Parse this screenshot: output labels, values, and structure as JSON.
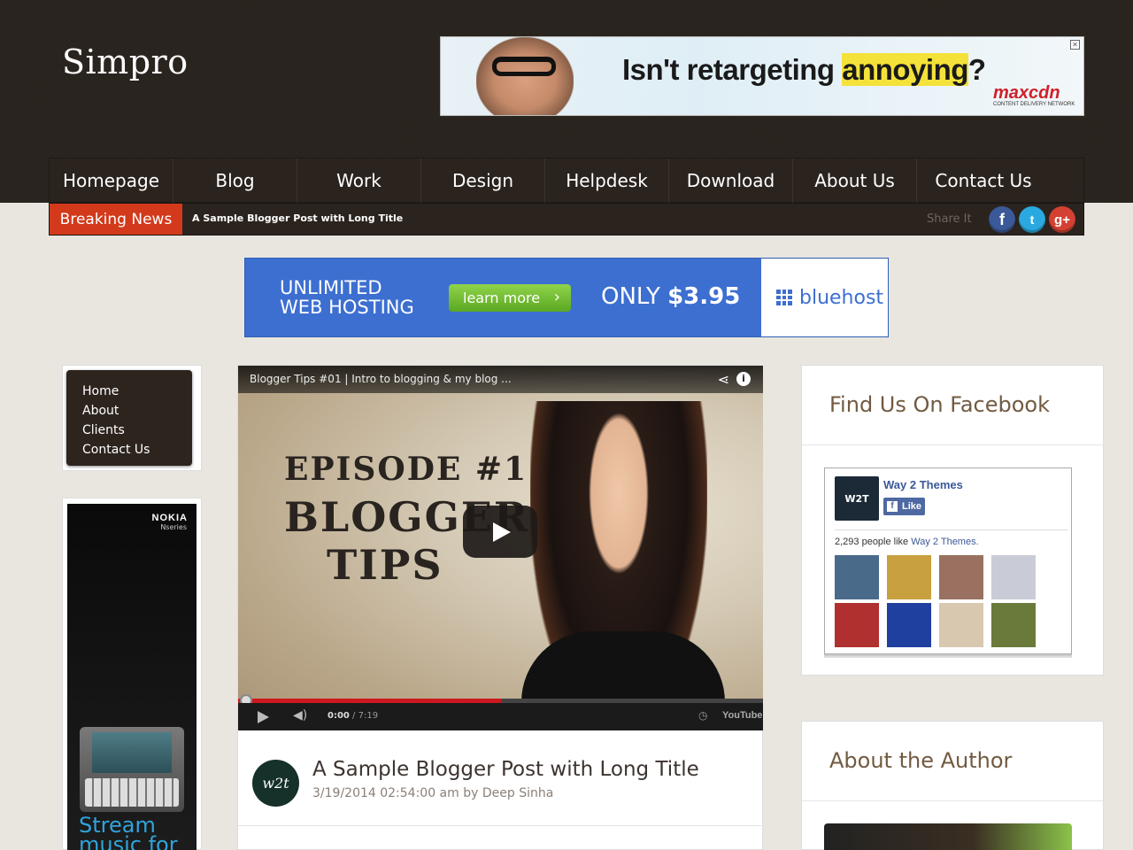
{
  "site": {
    "title": "Simpro"
  },
  "top_ad": {
    "headline_pre": "Isn't retargeting ",
    "headline_hl": "annoying",
    "headline_post": "?",
    "brand": "maxcdn",
    "brand_sub": "CONTENT DELIVERY NETWORK",
    "close": "✕"
  },
  "nav": {
    "items": [
      "Homepage",
      "Blog",
      "Work",
      "Design",
      "Helpdesk",
      "Download",
      "About Us",
      "Contact Us"
    ]
  },
  "breaking": {
    "label": "Breaking News",
    "text": "A Sample Blogger Post with Long Title",
    "share_label": "Share It",
    "social": [
      "f",
      "t",
      "g+"
    ]
  },
  "mid_ad": {
    "line1": "UNLIMITED",
    "line2": "WEB HOSTING",
    "button": "learn more",
    "price_pre": "ONLY ",
    "price": "$3.95",
    "brand": "bluehost"
  },
  "left_menu": {
    "items": [
      "Home",
      "About",
      "Clients",
      "Contact Us"
    ]
  },
  "side_ad": {
    "brand": "NOKIA",
    "sub": "Nseries",
    "tagline1": "Stream",
    "tagline2": "music for"
  },
  "video": {
    "title": "Blogger Tips #01 | Intro to blogging & my blog ...",
    "overlay_line1": "EPISODE #1",
    "overlay_line2": "BLOGGER",
    "overlay_line3": "TIPS",
    "time_current": "0:00",
    "time_total": " / 7:19",
    "progress": 0.5,
    "provider": "YouTube"
  },
  "post": {
    "avatar_text": "w2t",
    "title": "A Sample Blogger Post with Long Title",
    "meta": "3/19/2014 02:54:00 am by Deep Sinha"
  },
  "facebook_widget": {
    "title": "Find Us On Facebook",
    "page_name": "Way 2 Themes",
    "logo_text": "W2T",
    "like_label": "Like",
    "count_text": "2,293 people like ",
    "count_link": "Way 2 Themes.",
    "face_colors": [
      "#4a6a8a",
      "#c8a040",
      "#9a7060",
      "#c9ccd6",
      "#b03030",
      "#2040a0",
      "#d8c8b0",
      "#6a7a3a"
    ]
  },
  "author_widget": {
    "title": "About the Author"
  },
  "colors": {
    "nav_bg": "#2a231e",
    "breaking_red": "#d23a1b",
    "widget_title": "#725a40",
    "ad_blue": "#3d6fd1"
  }
}
